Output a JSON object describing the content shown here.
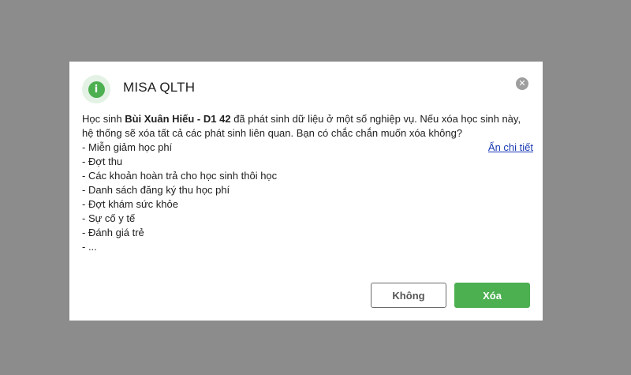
{
  "dialog": {
    "title": "MISA QLTH",
    "icon": "info-icon",
    "info_symbol": "i",
    "close_symbol": "✕",
    "accent_color": "#4caf50",
    "message": {
      "prefix": "Học sinh ",
      "student": "Bùi Xuân Hiếu - D1 42",
      "suffix": " đã phát sinh dữ liệu ở một số nghiệp vụ. Nếu xóa học sinh này, hệ thống sẽ xóa tất cả các phát sinh liên quan. Bạn có chắc chắn muốn xóa không?"
    },
    "items": [
      "- Miễn giảm học phí",
      "- Đợt thu",
      "- Các khoản hoàn trả cho học sinh thôi học",
      "- Danh sách đăng ký thu học phí",
      "- Đợt khám sức khỏe",
      "- Sự cố y tế",
      "- Đánh giá trẻ",
      "- ..."
    ],
    "hide_detail_link": "Ẩn chi tiết",
    "buttons": {
      "no": "Không",
      "yes": "Xóa"
    }
  }
}
